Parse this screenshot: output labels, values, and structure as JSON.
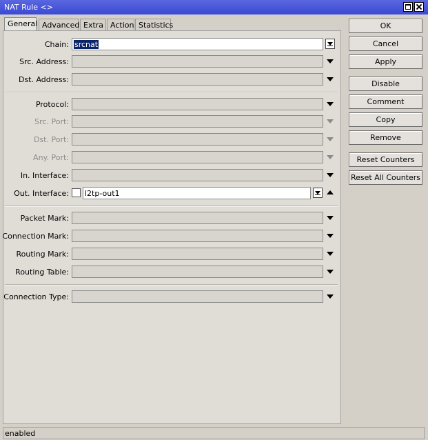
{
  "window": {
    "title": "NAT Rule <>"
  },
  "tabs": [
    "General",
    "Advanced",
    "Extra",
    "Action",
    "Statistics"
  ],
  "fields": {
    "chain": {
      "label": "Chain:",
      "value": "srcnat"
    },
    "src_address": {
      "label": "Src. Address:"
    },
    "dst_address": {
      "label": "Dst. Address:"
    },
    "protocol": {
      "label": "Protocol:"
    },
    "src_port": {
      "label": "Src. Port:"
    },
    "dst_port": {
      "label": "Dst. Port:"
    },
    "any_port": {
      "label": "Any. Port:"
    },
    "in_interface": {
      "label": "In. Interface:"
    },
    "out_interface": {
      "label": "Out. Interface:",
      "value": "l2tp-out1"
    },
    "packet_mark": {
      "label": "Packet Mark:"
    },
    "connection_mark": {
      "label": "Connection Mark:"
    },
    "routing_mark": {
      "label": "Routing Mark:"
    },
    "routing_table": {
      "label": "Routing Table:"
    },
    "connection_type": {
      "label": "Connection Type:"
    }
  },
  "buttons": {
    "ok": "OK",
    "cancel": "Cancel",
    "apply": "Apply",
    "disable": "Disable",
    "comment": "Comment",
    "copy": "Copy",
    "remove": "Remove",
    "reset_counters": "Reset Counters",
    "reset_all_counters": "Reset All Counters"
  },
  "status": {
    "text": "enabled"
  },
  "colors": {
    "titlebar": "#3b49d4",
    "selection": "#0a246a"
  }
}
